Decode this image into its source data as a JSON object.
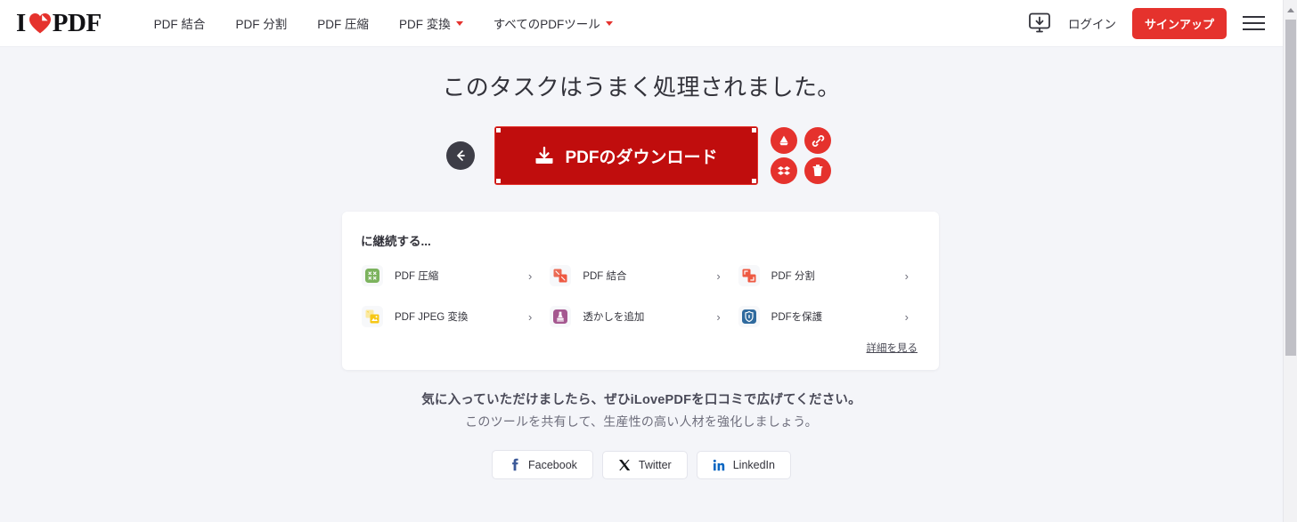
{
  "brand": {
    "logo_part1": "I",
    "logo_part2": "PDF",
    "accent_color": "#e5322d",
    "dark_color": "#33333b"
  },
  "header": {
    "nav": [
      {
        "label": "PDF 結合",
        "has_caret": false
      },
      {
        "label": "PDF 分割",
        "has_caret": false
      },
      {
        "label": "PDF 圧縮",
        "has_caret": false
      },
      {
        "label": "PDF 変換",
        "has_caret": true
      },
      {
        "label": "すべてのPDFツール",
        "has_caret": true
      }
    ],
    "desktop_icon": "desktop-download-icon",
    "login_label": "ログイン",
    "signup_label": "サインアップ",
    "menu_icon": "hamburger-menu-icon"
  },
  "main": {
    "success_title": "このタスクはうまく処理されました。",
    "back_icon": "arrow-left-icon",
    "download_button": {
      "label": "PDFのダウンロード",
      "icon": "download-icon",
      "bg_color": "#c00d0d"
    },
    "side_actions": [
      {
        "name": "google-drive",
        "icon": "google-drive-icon"
      },
      {
        "name": "copy-link",
        "icon": "link-icon"
      },
      {
        "name": "dropbox",
        "icon": "dropbox-icon"
      },
      {
        "name": "delete",
        "icon": "trash-icon"
      }
    ]
  },
  "continue_card": {
    "title": "に継続する...",
    "tools": [
      {
        "label": "PDF 圧縮",
        "icon": "compress-pdf-icon",
        "color": "#7cb35e",
        "arrow": "›"
      },
      {
        "label": "PDF 結合",
        "icon": "merge-pdf-icon",
        "color": "#eb6b55",
        "arrow": "›"
      },
      {
        "label": "PDF 分割",
        "icon": "split-pdf-icon",
        "color": "#ee5a43",
        "arrow": "›"
      },
      {
        "label": "PDF JPEG 変換",
        "icon": "pdf-to-jpg-icon",
        "color": "#f6c715",
        "arrow": "›"
      },
      {
        "label": "透かしを追加",
        "icon": "watermark-icon",
        "color": "#a55890",
        "arrow": "›"
      },
      {
        "label": "PDFを保護",
        "icon": "protect-pdf-icon",
        "color": "#2f6a9e",
        "arrow": "›"
      }
    ],
    "see_more_label": "詳細を見る"
  },
  "share": {
    "line1": "気に入っていただけましたら、ぜひiLovePDFを口コミで広げてください。",
    "line2": "このツールを共有して、生産性の高い人材を強化しましょう。",
    "buttons": [
      {
        "label": "Facebook",
        "icon": "facebook-icon",
        "color": "#3b5998"
      },
      {
        "label": "Twitter",
        "icon": "twitter-x-icon",
        "color": "#14171a"
      },
      {
        "label": "LinkedIn",
        "icon": "linkedin-icon",
        "color": "#0a66c2"
      }
    ]
  },
  "scrollbar": {
    "up_arrow_icon": "scroll-up-arrow-icon"
  }
}
